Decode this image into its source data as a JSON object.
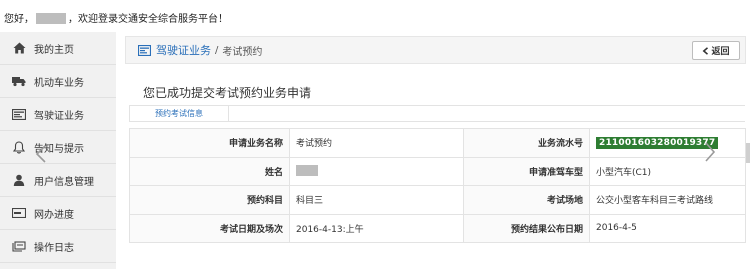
{
  "header": {
    "greeting_prefix": "您好，",
    "greeting_suffix": "，欢迎登录交通安全综合服务平台！"
  },
  "sidebar": {
    "items": [
      {
        "label": "我的主页",
        "icon": "home-icon"
      },
      {
        "label": "机动车业务",
        "icon": "truck-icon"
      },
      {
        "label": "驾驶证业务",
        "icon": "card-icon"
      },
      {
        "label": "告知与提示",
        "icon": "bell-icon"
      },
      {
        "label": "用户信息管理",
        "icon": "user-icon"
      },
      {
        "label": "网办进度",
        "icon": "progress-icon"
      },
      {
        "label": "操作日志",
        "icon": "log-icon"
      }
    ]
  },
  "breadcrumb": {
    "section": "驾驶证业务",
    "separator": "/",
    "current": "考试预约"
  },
  "back_button": {
    "label": "返回"
  },
  "main": {
    "success_title": "您已成功提交考试预约业务申请",
    "tab_label": "预约考试信息"
  },
  "info": {
    "rows": [
      {
        "k1": "申请业务名称",
        "v1": "考试预约",
        "k2": "业务流水号",
        "v2": "211001603280019377"
      },
      {
        "k1": "姓名",
        "v1": "",
        "k2": "申请准驾车型",
        "v2": "小型汽车(C1)"
      },
      {
        "k1": "预约科目",
        "v1": "科目三",
        "k2": "考试场地",
        "v2": "公交小型客车科目三考试路线"
      },
      {
        "k1": "考试日期及场次",
        "v1": "2016-4-13:上午",
        "k2": "预约结果公布日期",
        "v2": "2016-4-5"
      }
    ]
  },
  "colors": {
    "link_blue": "#2a6fb9",
    "serial_green": "#2e7d32",
    "sidebar_bg": "#f1f1f1"
  }
}
